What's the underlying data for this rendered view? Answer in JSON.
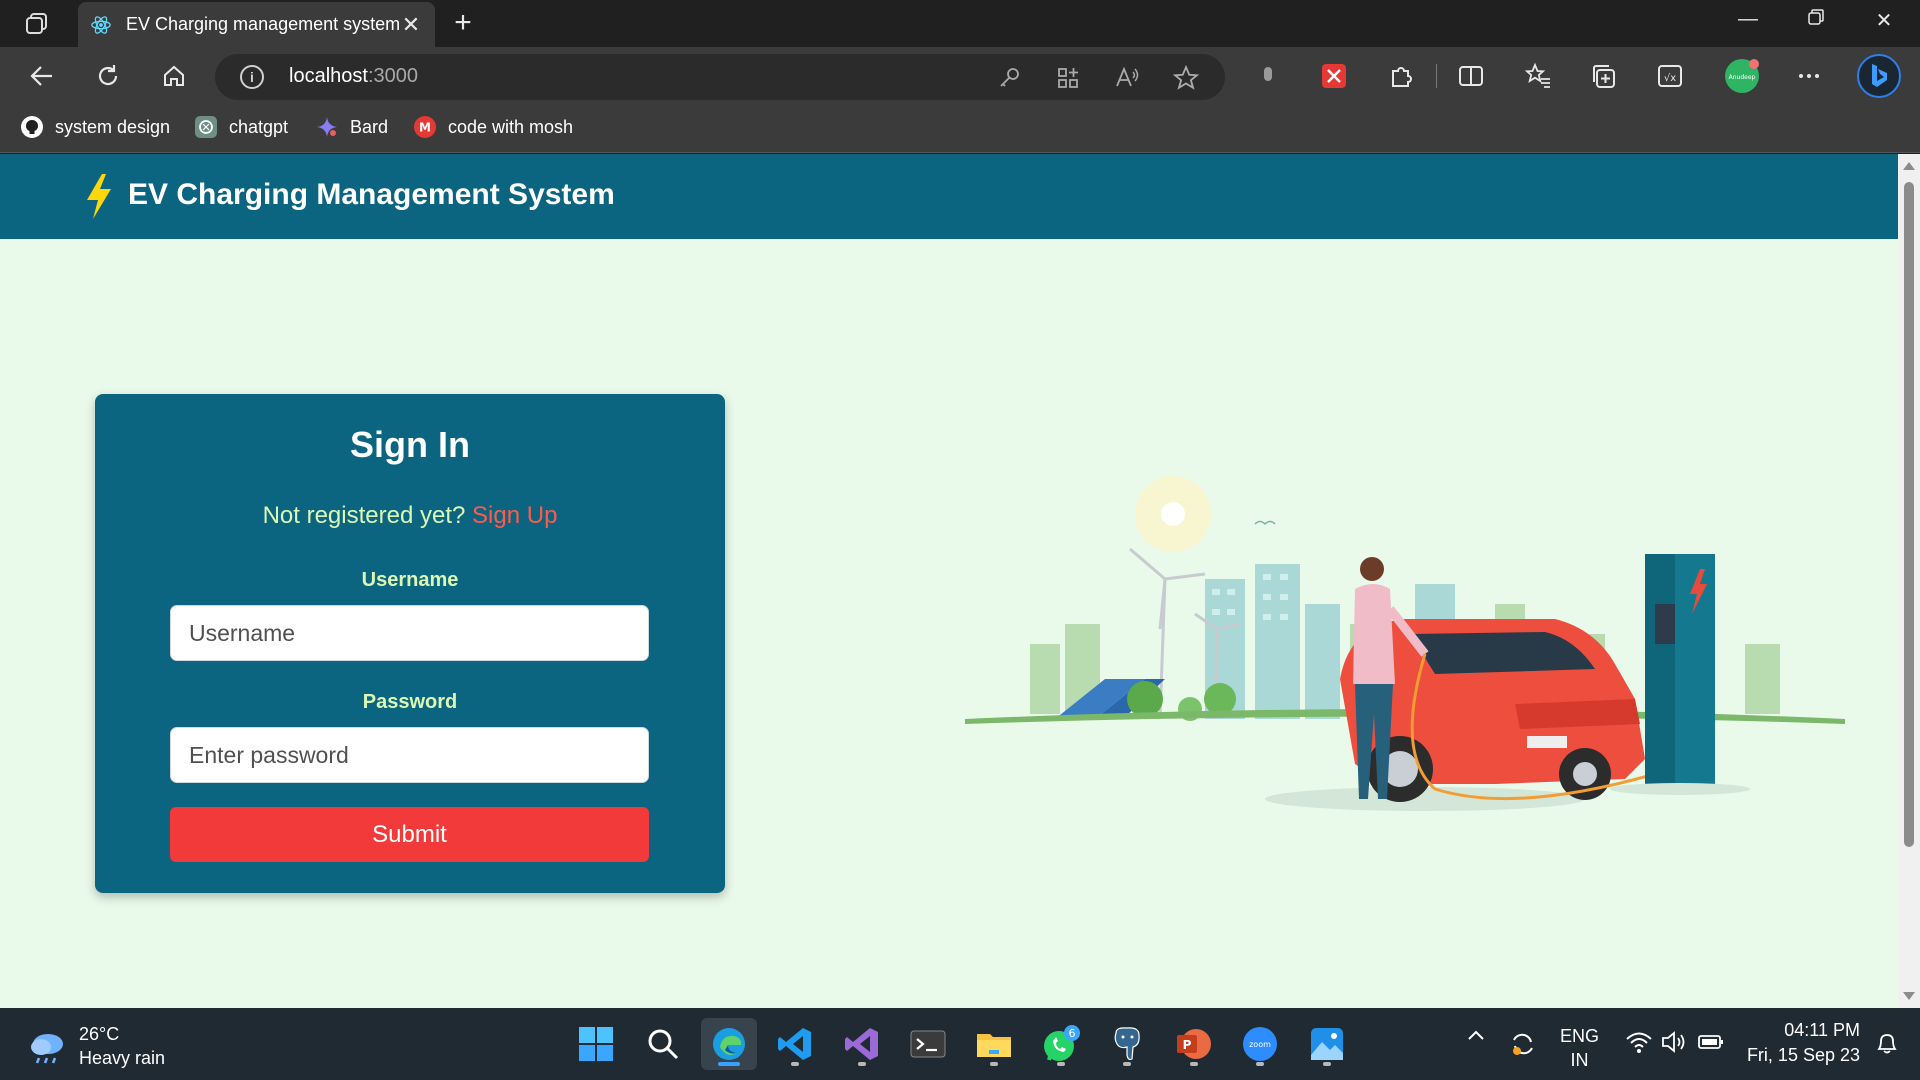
{
  "browser": {
    "tab_title": "EV Charging management system",
    "address": {
      "host": "localhost",
      "port": ":3000"
    },
    "bookmarks": [
      {
        "label": "system design",
        "icon": "github-icon"
      },
      {
        "label": "chatgpt",
        "icon": "chatgpt-icon"
      },
      {
        "label": "Bard",
        "icon": "bard-icon"
      },
      {
        "label": "code with mosh",
        "icon": "mosh-icon"
      }
    ]
  },
  "app": {
    "brand": "EV Charging Management System",
    "colors": {
      "header": "#0b6580",
      "page_bg": "#eafaea",
      "accent_red": "#f33a3a",
      "label_green": "#dbf7b4"
    }
  },
  "signin": {
    "title": "Sign In",
    "not_registered": "Not registered yet?",
    "signup_link": "Sign Up",
    "username_label": "Username",
    "username_placeholder": "Username",
    "password_label": "Password",
    "password_placeholder": "Enter password",
    "submit_label": "Submit"
  },
  "taskbar": {
    "weather": {
      "temp": "26°C",
      "condition": "Heavy rain"
    },
    "whatsapp_badge": "6",
    "language": {
      "line1": "ENG",
      "line2": "IN"
    },
    "clock": {
      "time": "04:11 PM",
      "date": "Fri, 15 Sep 23"
    }
  }
}
